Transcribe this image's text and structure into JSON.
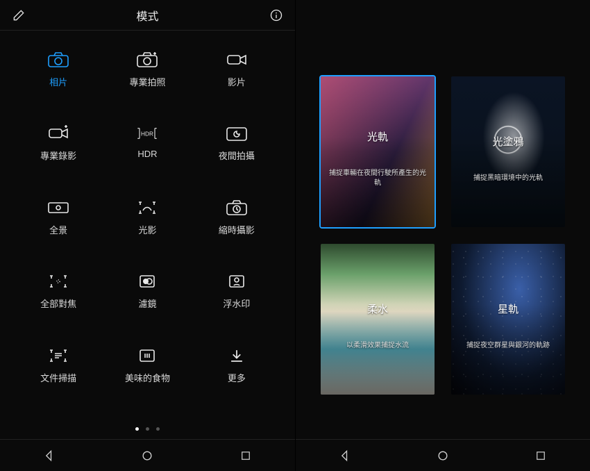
{
  "left": {
    "header": {
      "title": "模式"
    },
    "modes": [
      {
        "icon": "camera",
        "label": "相片",
        "active": true
      },
      {
        "icon": "camera-pro",
        "label": "專業拍照",
        "active": false
      },
      {
        "icon": "video",
        "label": "影片",
        "active": false
      },
      {
        "icon": "video-pro",
        "label": "專業錄影",
        "active": false
      },
      {
        "icon": "hdr",
        "label": "HDR",
        "active": false
      },
      {
        "icon": "night",
        "label": "夜間拍攝",
        "active": false
      },
      {
        "icon": "panorama",
        "label": "全景",
        "active": false
      },
      {
        "icon": "light-paint",
        "label": "光影",
        "active": false
      },
      {
        "icon": "timelapse",
        "label": "縮時攝影",
        "active": false
      },
      {
        "icon": "all-focus",
        "label": "全部對焦",
        "active": false
      },
      {
        "icon": "filter",
        "label": "濾鏡",
        "active": false
      },
      {
        "icon": "watermark",
        "label": "浮水印",
        "active": false
      },
      {
        "icon": "doc-scan",
        "label": "文件掃描",
        "active": false
      },
      {
        "icon": "food",
        "label": "美味的食物",
        "active": false
      },
      {
        "icon": "more",
        "label": "更多",
        "active": false
      }
    ],
    "pager": {
      "count": 3,
      "active": 0
    }
  },
  "right": {
    "cards": [
      {
        "title": "光軌",
        "desc": "捕捉車輛在夜間行駛所產生的光軌",
        "selected": true,
        "bg": "city"
      },
      {
        "title": "光塗鴉",
        "desc": "捕捉黑暗環境中的光軌",
        "selected": false,
        "bg": "light"
      },
      {
        "title": "柔水",
        "desc": "以柔滑效果捕捉水流",
        "selected": false,
        "bg": "water"
      },
      {
        "title": "星軌",
        "desc": "捕捉夜空群星與銀河的軌跡",
        "selected": false,
        "bg": "stars"
      }
    ]
  },
  "nav": {
    "back": "back",
    "home": "home",
    "recent": "recent"
  }
}
